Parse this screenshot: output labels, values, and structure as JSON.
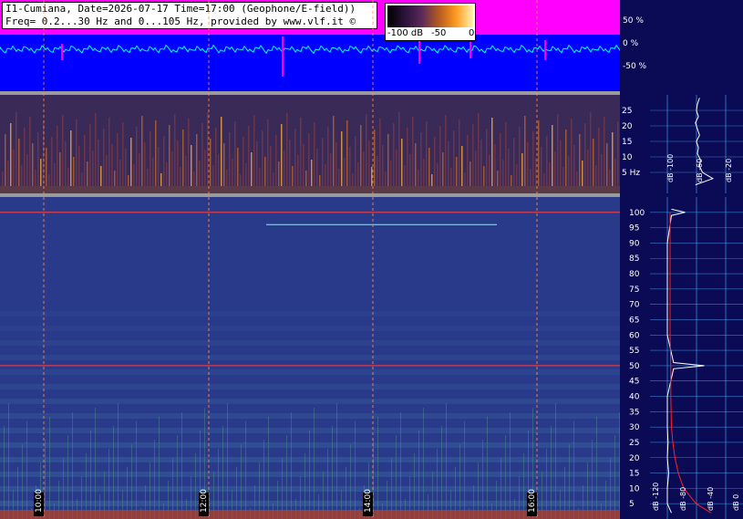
{
  "title_line1": "I1-Cumiana, Date=2026-07-17 Time=17:00 (Geophone/E-field))",
  "title_line2": "Freq= 0.2...30 Hz and 0...105 Hz, provided by www.vlf.it ©",
  "colorbar": {
    "labels": [
      "-100 dB",
      "-50",
      "0"
    ]
  },
  "colors": {
    "waveform_bg": "#0000ff",
    "amplitude_envelope": "#ff00ff",
    "trace": "#00ffff",
    "marker_lines": "#ff4040",
    "grid": "#4ab0ff"
  },
  "chart_data": [
    {
      "type": "line",
      "panel": "waveform",
      "y_tick_labels": [
        "50 %",
        "0 %",
        "-50 %"
      ],
      "ylim": [
        -100,
        100
      ],
      "grid": true
    },
    {
      "type": "heatmap",
      "panel": "spectrogram-low",
      "ylim": [
        0,
        30
      ],
      "y_ticks": [
        5,
        10,
        15,
        20,
        25
      ],
      "y_tick_labels": [
        "5 Hz",
        "10",
        "15",
        "20",
        "25"
      ],
      "color_scale": "dB"
    },
    {
      "type": "heatmap",
      "panel": "spectrogram-high",
      "ylim": [
        0,
        105
      ],
      "y_ticks": [
        5,
        10,
        15,
        20,
        25,
        30,
        35,
        40,
        45,
        50,
        55,
        60,
        65,
        70,
        75,
        80,
        85,
        90,
        95,
        100
      ],
      "y_tick_labels": [
        "5",
        "10",
        "15",
        "20",
        "25",
        "30",
        "35",
        "40",
        "45",
        "50",
        "55",
        "60",
        "65",
        "70",
        "75",
        "80",
        "85",
        "90",
        "95",
        "100"
      ],
      "marker_lines_hz": [
        50,
        100
      ],
      "color_scale": "dB"
    },
    {
      "type": "line",
      "panel": "spectrum-low",
      "x_tick_labels": [
        "dB -100",
        "dB -60",
        "dB -20"
      ],
      "series": [
        {
          "color": "#ffffff",
          "y": [
            1,
            3,
            5,
            7,
            9,
            11,
            13,
            15,
            17,
            19,
            21,
            23,
            25,
            27,
            29
          ],
          "x": [
            -62,
            -45,
            -55,
            -58,
            -57,
            -60,
            -59,
            -61,
            -58,
            -60,
            -62,
            -59,
            -61,
            -60,
            -58
          ]
        }
      ]
    },
    {
      "type": "line",
      "panel": "spectrum-high",
      "x_tick_labels": [
        "dB -120",
        "dB -80",
        "dB -40",
        "dB 0"
      ],
      "series": [
        {
          "color": "#ffffff",
          "y": [
            2,
            5,
            10,
            15,
            20,
            25,
            30,
            40,
            49,
            50,
            51,
            60,
            70,
            80,
            90,
            99,
            100,
            101
          ],
          "x": [
            -98,
            -104,
            -104,
            -102,
            -104,
            -103,
            -104,
            -104,
            -95,
            -50,
            -95,
            -104,
            -104,
            -104,
            -104,
            -98,
            -78,
            -98
          ]
        },
        {
          "color": "#ff2020",
          "y": [
            2,
            5,
            10,
            15,
            20,
            25,
            30,
            40,
            50,
            60,
            70,
            80,
            90,
            100
          ],
          "x": [
            -40,
            -62,
            -80,
            -88,
            -93,
            -96,
            -98,
            -99,
            -99,
            -100,
            -100,
            -100,
            -100,
            -100
          ]
        }
      ]
    }
  ],
  "time_axis": {
    "labels": [
      "10:00",
      "12:00",
      "14:00",
      "16:00"
    ]
  }
}
